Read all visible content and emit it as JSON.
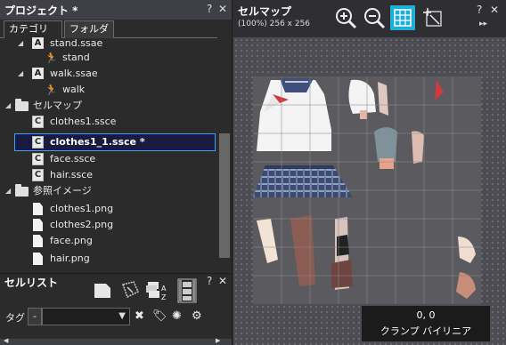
{
  "project": {
    "title": "プロジェクト *",
    "help": "?",
    "close": "✕",
    "tabs": [
      {
        "label": "カテゴリ",
        "active": true
      },
      {
        "label": "フォルダ",
        "active": false
      }
    ],
    "tree": [
      {
        "label": "stand.ssae",
        "icon": "anime-file-icon",
        "expanded": true
      },
      {
        "label": "stand",
        "icon": "motion-icon"
      },
      {
        "label": "walk.ssae",
        "icon": "anime-file-icon",
        "expanded": true
      },
      {
        "label": "walk",
        "icon": "motion-icon"
      },
      {
        "label": "セルマップ",
        "icon": "folder-icon",
        "expanded": true
      },
      {
        "label": "clothes1.ssce",
        "icon": "cellmap-file-icon"
      },
      {
        "label": "clothes1_1.ssce *",
        "icon": "cellmap-file-icon",
        "selected": true
      },
      {
        "label": "face.ssce",
        "icon": "cellmap-file-icon"
      },
      {
        "label": "hair.ssce",
        "icon": "cellmap-file-icon"
      },
      {
        "label": "参照イメージ",
        "icon": "folder-icon",
        "expanded": true
      },
      {
        "label": "clothes1.png",
        "icon": "image-file-icon"
      },
      {
        "label": "clothes2.png",
        "icon": "image-file-icon"
      },
      {
        "label": "face.png",
        "icon": "image-file-icon"
      },
      {
        "label": "hair.png",
        "icon": "image-file-icon"
      }
    ]
  },
  "celllist": {
    "title": "セルリスト",
    "help": "?",
    "close": "✕",
    "toolbar": [
      "new-cell-icon",
      "edit-cell-icon",
      "sort-icon",
      "filmstrip-icon"
    ],
    "tag_label": "タグ",
    "tag_minus": "-",
    "tag_value": "",
    "tag_actions": [
      "delete-icon",
      "tag-icon",
      "sparkle-icon",
      "settings-icon"
    ]
  },
  "cellmap": {
    "title": "セルマップ",
    "zoom_info": "(100%) 256 x 256",
    "help": "?",
    "close": "✕",
    "more": "▸▸",
    "tools": [
      "zoom-in-icon",
      "zoom-out-icon",
      "grid-icon",
      "origin-icon"
    ],
    "grid_active": true,
    "coord": "0, 0",
    "mode": "クランプ バイリニア"
  },
  "colors": {
    "accent": "#1faed8",
    "selection_border": "#3aa0ff",
    "selection_bg": "#1a1a40",
    "panel_bg": "#2b2b2b",
    "titlebar": "#3f3f46"
  }
}
